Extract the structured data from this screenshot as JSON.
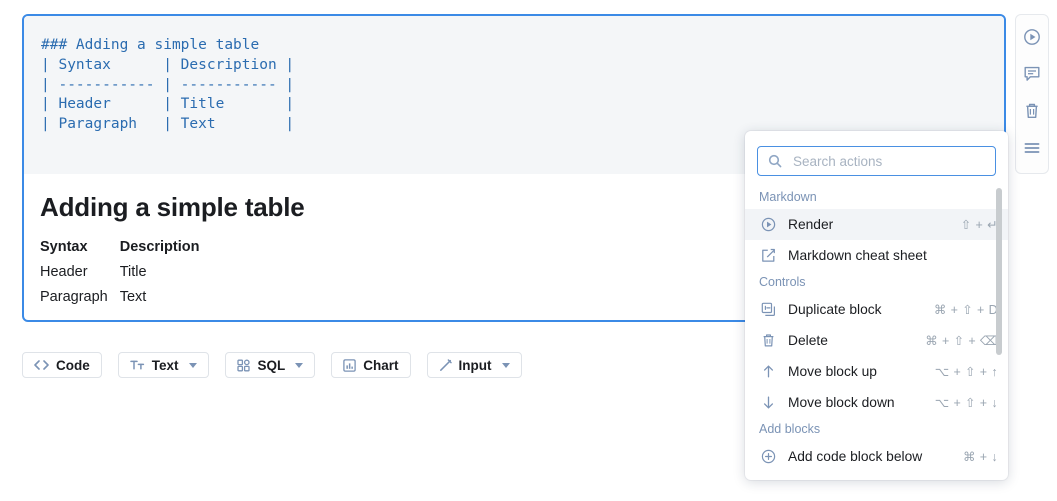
{
  "block": {
    "code_lines": [
      "### Adding a simple table",
      "| Syntax      | Description |",
      "| ----------- | ----------- |",
      "| Header      | Title       |",
      "| Paragraph   | Text        |"
    ],
    "preview": {
      "title": "Adding a simple table",
      "table": {
        "headers": [
          "Syntax",
          "Description"
        ],
        "rows": [
          [
            "Header",
            "Title"
          ],
          [
            "Paragraph",
            "Text"
          ]
        ]
      }
    },
    "accent_color": "#3b8ae6",
    "code_text_color": "#2b6cb0",
    "code_bg_color": "#f4f6f8"
  },
  "toolbar": {
    "buttons": [
      {
        "label": "Code",
        "icon": "code-brackets-icon",
        "caret": false
      },
      {
        "label": "Text",
        "icon": "text-format-icon",
        "caret": true
      },
      {
        "label": "SQL",
        "icon": "blocks-grid-icon",
        "caret": true
      },
      {
        "label": "Chart",
        "icon": "bar-chart-icon",
        "caret": false
      },
      {
        "label": "Input",
        "icon": "pencil-icon",
        "caret": true
      }
    ]
  },
  "icon_rail": {
    "items": [
      {
        "icon": "play-circle-icon",
        "name": "run-block"
      },
      {
        "icon": "comment-icon",
        "name": "comment-block"
      },
      {
        "icon": "trash-icon",
        "name": "delete-block"
      },
      {
        "icon": "menu-icon",
        "name": "block-actions-menu"
      }
    ]
  },
  "actions_menu": {
    "search": {
      "placeholder": "Search actions",
      "value": "",
      "icon": "search-icon"
    },
    "sections": [
      {
        "label": "Markdown",
        "items": [
          {
            "label": "Render",
            "icon": "play-circle-icon",
            "shortcut": "⇧ + ↵",
            "highlighted": true
          },
          {
            "label": "Markdown cheat sheet",
            "icon": "edit-square-icon",
            "shortcut": "",
            "highlighted": false
          }
        ]
      },
      {
        "label": "Controls",
        "items": [
          {
            "label": "Duplicate block",
            "icon": "duplicate-icon",
            "shortcut": "⌘ + ⇧ + D",
            "highlighted": false
          },
          {
            "label": "Delete",
            "icon": "trash-icon",
            "shortcut": "⌘ + ⇧ + ⌫",
            "highlighted": false
          },
          {
            "label": "Move block up",
            "icon": "arrow-up-icon",
            "shortcut": "⌥ + ⇧ + ↑",
            "highlighted": false
          },
          {
            "label": "Move block down",
            "icon": "arrow-down-icon",
            "shortcut": "⌥ + ⇧ + ↓",
            "highlighted": false
          }
        ]
      },
      {
        "label": "Add blocks",
        "items": [
          {
            "label": "Add code block below",
            "icon": "plus-circle-icon",
            "shortcut": "⌘ + ↓",
            "highlighted": false
          }
        ]
      }
    ]
  }
}
